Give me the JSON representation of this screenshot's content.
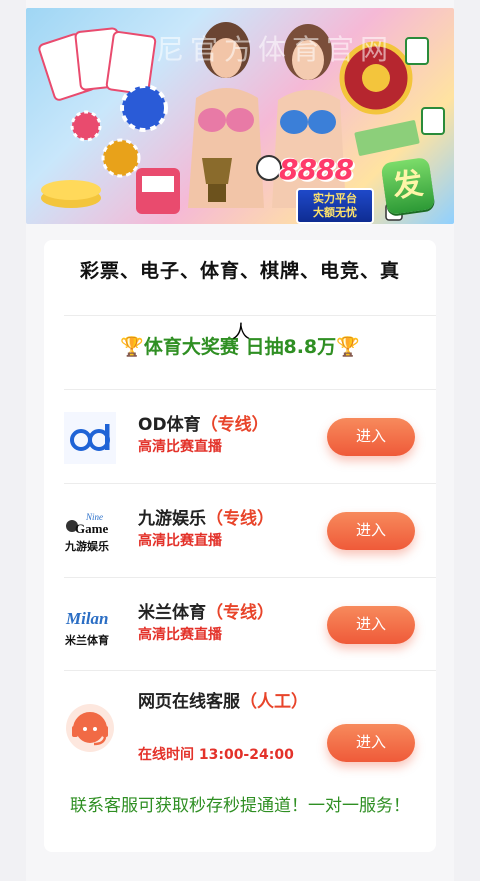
{
  "banner": {
    "watermark": "克尼官方体育官网",
    "badge_number": "8888",
    "badge_text_line1": "实力平台",
    "badge_text_line2": "大额无忧",
    "badge_char": "发"
  },
  "marquee": {
    "text": "彩票、电子、体育、棋牌、电竞、真"
  },
  "promo": {
    "trophy_left": "🏆",
    "text": "体育大奖赛 日抽8.8万",
    "trophy_right": "🏆"
  },
  "cursor_glyph": "人",
  "rows": [
    {
      "title": "OD体育",
      "tag": "（专线）",
      "subtitle": "高清比赛直播",
      "button": "进入",
      "logo": "od-logo"
    },
    {
      "title": "九游娱乐",
      "tag": "（专线）",
      "subtitle": "高清比赛直播",
      "button": "进入",
      "logo": "nine-game-logo",
      "logo_text_1": "Nine",
      "logo_text_2": "Game",
      "logo_text_3": "九游娱乐"
    },
    {
      "title": "米兰体育",
      "tag": "（专线）",
      "subtitle": "高清比赛直播",
      "button": "进入",
      "logo": "milan-logo",
      "logo_text_1": "Milan",
      "logo_text_2": "米兰体育"
    },
    {
      "title": "网页在线客服",
      "tag": "（人工）",
      "subtitle": "在线时间 13:00-24:00",
      "button": "进入",
      "logo": "customer-service-icon"
    }
  ],
  "footer": {
    "text": "联系客服可获取秒存秒提通道！一对一服务！"
  },
  "colors": {
    "accent": "#ef5a39",
    "green": "#2f8f23",
    "red": "#e3322a"
  }
}
